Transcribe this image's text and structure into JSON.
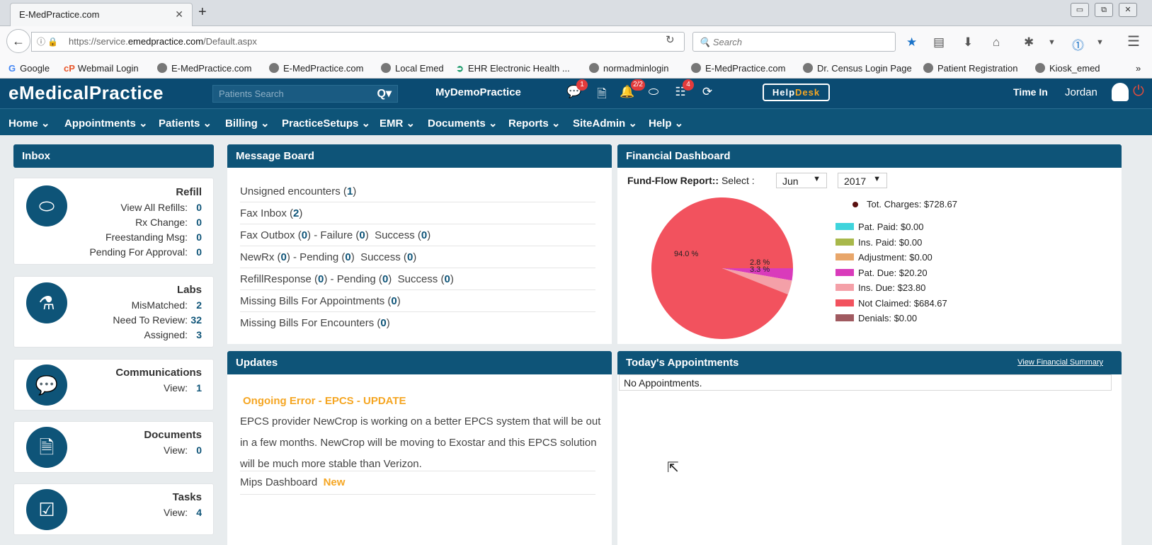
{
  "browser": {
    "tab_title": "E-MedPractice.com",
    "url_prefix": "https://service.",
    "url_domain": "emedpractice.com",
    "url_path": "/Default.aspx",
    "search_placeholder": "Search",
    "bookmarks": [
      "Google",
      "Webmail Login",
      "E-MedPractice.com",
      "E-MedPractice.com",
      "Local Emed",
      "EHR Electronic Health ...",
      "normadminlogin",
      "E-MedPractice.com",
      "Dr. Census Login Page",
      "Patient Registration",
      "Kiosk_emed"
    ],
    "overflow": "»"
  },
  "app": {
    "logo": "eMedicalPractice",
    "search_placeholder": "Patients Search",
    "practice": "MyDemoPractice",
    "badges": {
      "messages": "1",
      "alerts": "2/2",
      "tasks": "4"
    },
    "help": "Help",
    "desk": "Desk",
    "time_in": "Time In",
    "user": "Jordan"
  },
  "menu": [
    "Home",
    "Appointments",
    "Patients",
    "Billing",
    "PracticeSetups",
    "EMR",
    "Documents",
    "Reports",
    "SiteAdmin",
    "Help"
  ],
  "inbox": {
    "title": "Inbox",
    "refill": {
      "title": "Refill",
      "rows": [
        {
          "label": "View All Refills:",
          "value": "0"
        },
        {
          "label": "Rx Change:",
          "value": "0"
        },
        {
          "label": "Freestanding Msg:",
          "value": "0"
        },
        {
          "label": "Pending For Approval:",
          "value": "0"
        }
      ]
    },
    "labs": {
      "title": "Labs",
      "rows": [
        {
          "label": "MisMatched:",
          "value": "2"
        },
        {
          "label": "Need To Review:",
          "value": "32"
        },
        {
          "label": "Assigned:",
          "value": "3"
        }
      ]
    },
    "communications": {
      "title": "Communications",
      "rows": [
        {
          "label": "View:",
          "value": "1"
        }
      ]
    },
    "documents": {
      "title": "Documents",
      "rows": [
        {
          "label": "View:",
          "value": "0"
        }
      ]
    },
    "tasks": {
      "title": "Tasks",
      "rows": [
        {
          "label": "View:",
          "value": "4"
        }
      ]
    }
  },
  "message_board": {
    "title": "Message Board",
    "rows": [
      {
        "a": "Unsigned encounters (",
        "v1": "1",
        "b": ")"
      },
      {
        "a": "Fax Inbox (",
        "v1": "2",
        "b": ")"
      },
      {
        "a": "Fax Outbox (",
        "v1": "0",
        "b": ") - Failure (",
        "v2": "0",
        "c": ")  Success (",
        "v3": "0",
        "d": ")"
      },
      {
        "a": "NewRx (",
        "v1": "0",
        "b": ") - Pending (",
        "v2": "0",
        "c": ")  Success (",
        "v3": "0",
        "d": ")"
      },
      {
        "a": "RefillResponse (",
        "v1": "0",
        "b": ") - Pending (",
        "v2": "0",
        "c": ")  Success (",
        "v3": "0",
        "d": ")"
      },
      {
        "a": "Missing Bills For Appointments (",
        "v1": "0",
        "b": ")"
      },
      {
        "a": "Missing Bills For Encounters (",
        "v1": "0",
        "b": ")"
      }
    ]
  },
  "updates": {
    "title": "Updates",
    "headline": "Ongoing Error - EPCS - UPDATE",
    "body": "EPCS provider NewCrop is working on a better EPCS system that will be out in a few months. NewCrop will be moving to Exostar and this EPCS solution will be much more stable than Verizon.",
    "mips": "Mips Dashboard",
    "mips_new": "New"
  },
  "financial": {
    "title": "Financial Dashboard",
    "report_label": "Fund-Flow Report::",
    "select_label": "Select :",
    "month": "Jun",
    "year": "2017",
    "total": "Tot. Charges: $728.67"
  },
  "chart_data": {
    "type": "pie",
    "slices": [
      {
        "name": "Pat. Paid",
        "label": "Pat. Paid:  $0.00",
        "value": 0.0,
        "color": "#3fd4dc"
      },
      {
        "name": "Ins. Paid",
        "label": "Ins. Paid:  $0.00",
        "value": 0.0,
        "color": "#a8b84a"
      },
      {
        "name": "Adjustment",
        "label": "Adjustment:  $0.00",
        "value": 0.0,
        "color": "#e8a66a"
      },
      {
        "name": "Pat. Due",
        "label": "Pat. Due:  $20.20",
        "value": 20.2,
        "color": "#d93bbb"
      },
      {
        "name": "Ins. Due",
        "label": "Ins. Due:  $23.80",
        "value": 23.8,
        "color": "#f4a0a8"
      },
      {
        "name": "Not Claimed",
        "label": "Not Claimed:  $684.67",
        "value": 684.67,
        "color": "#f2525e"
      },
      {
        "name": "Denials",
        "label": "Denials:  $0.00",
        "value": 0.0,
        "color": "#a05a60"
      }
    ],
    "pct_labels": [
      "2.8 %",
      "3.3 %",
      "94.0 %"
    ]
  },
  "appointments": {
    "title": "Today's Appointments",
    "link": "View Financial Summary",
    "empty": "No Appointments."
  }
}
